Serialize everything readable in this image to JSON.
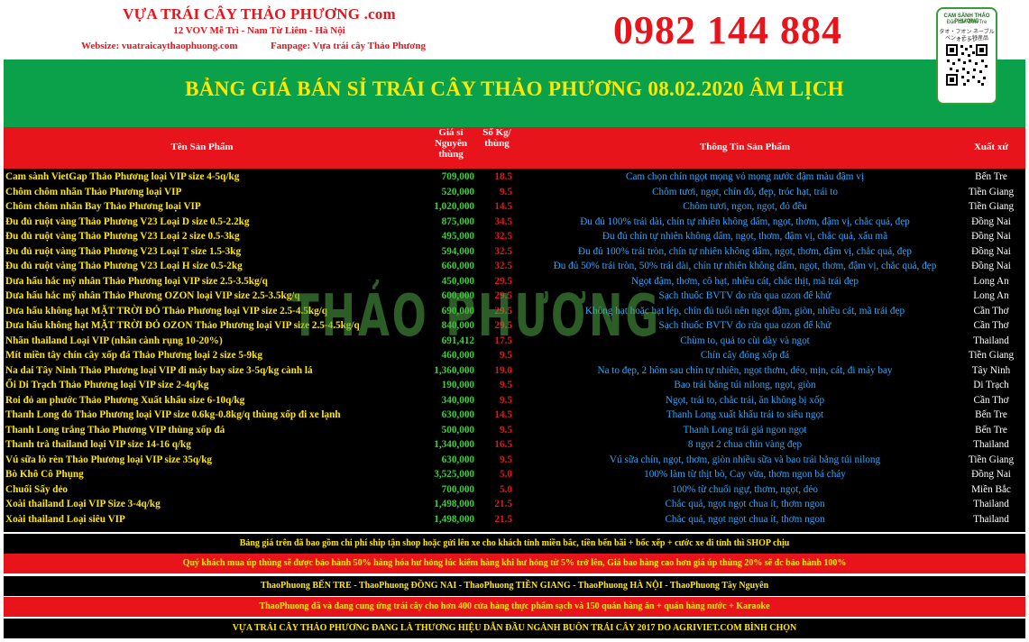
{
  "header": {
    "shop_name": "VỰA TRÁI CÂY THẢO PHƯƠNG .com",
    "address": "12 VOV Mễ Trì - Nam Từ Liêm - Hà Nội",
    "website": "Websize: vuatraicaythaophuong.com",
    "fanpage": "Fanpage: Vựa trái cây Thảo Phương",
    "phone": "0982 144 884",
    "badge_line1": "CAM SÀNH THẢO PHƯƠNG",
    "badge_line2": "Đặc sản Bến Tre",
    "badge_line3": "タオ・フオン ネーブルオレンジ",
    "badge_line4": "ベン・チェ特産品"
  },
  "title": "BẢNG GIÁ BÁN SỈ TRÁI CÂY THẢO PHƯƠNG 08.02.2020 ÂM LỊCH",
  "columns": {
    "name": "Tên Sản Phẩm",
    "price": "Giá sỉ Nguyên thùng",
    "kg": "Số Kg/ thùng",
    "info": "Thông Tin Sản Phẩm",
    "origin": "Xuất xứ"
  },
  "watermark": "THẢO PHƯƠNG",
  "products": [
    {
      "name": "Cam sành VietGap Thảo Phương loại VIP size 4-5q/kg",
      "price": "709,000",
      "kg": "18.5",
      "info": "Cam chọn chín ngọt mọng vỏ mọng nước đậm màu đậm vị",
      "origin": "Bến Tre"
    },
    {
      "name": "Chôm chôm nhãn Thảo Phương loại VIP",
      "price": "520,000",
      "kg": "9.5",
      "info": "Chôm tươi, ngọt, chín đỏ, đẹp, tróc hạt, trái to",
      "origin": "Tiền Giang"
    },
    {
      "name": "Chôm chôm nhãn Bay Thảo Phương loại VIP",
      "price": "1,020,000",
      "kg": "14.5",
      "info": "Chôm tươi, ngon, ngọt, đỏ đều",
      "origin": "Tiền Giang"
    },
    {
      "name": "Đu đủ ruột vàng Thảo Phương V23 Loại D size 0.5-2.2kg",
      "price": "875,000",
      "kg": "34.5",
      "info": "Đu đủ 100% trái dài, chín tự nhiên không dấm, ngọt, thơm, đậm vị, chắc quả, đẹp",
      "origin": "Đồng Nai"
    },
    {
      "name": "Đu đủ ruột vàng Thảo Phương V23 Loại 2 size 0.5-3kg",
      "price": "495,000",
      "kg": "32.5",
      "info": "Đu đủ chín tự nhiên không dấm, ngọt, thơm, đậm vị, chắc quả, xấu mã",
      "origin": "Đồng Nai"
    },
    {
      "name": "Đu đủ ruột vàng Thảo Phương V23 Loại T size 1.5-3kg",
      "price": "594,000",
      "kg": "32.5",
      "info": "Đu đủ 100% trái tròn, chín tự nhiên không dấm, ngọt, thơm, đậm vị, chắc quả, đẹp",
      "origin": "Đồng Nai"
    },
    {
      "name": "Đu đủ ruột vàng Thảo Phương V23 Loại H size 0.5-2kg",
      "price": "660,000",
      "kg": "32.5",
      "info": "Đu đủ 50% trái tròn, 50% trái dài, chín tự nhiên không dấm, ngọt, thơm, đậm vị, chắc quả, đẹp",
      "origin": "Đồng Nai"
    },
    {
      "name": "Dưa hấu hắc mỹ nhân Thảo Phương loại VIP size 2.5-3.5kg/q",
      "price": "450,000",
      "kg": "29.5",
      "info": "Ngọt đậm, thơm, cô hạt, nhiều cát, chắc thịt, mã trái đẹp",
      "origin": "Long An"
    },
    {
      "name": "Dưa hấu hắc mỹ nhân Thảo Phương OZON loại VIP size 2.5-3.5kg/q",
      "price": "600,000",
      "kg": "29.5",
      "info": "Sạch thuốc BVTV do rửa qua ozon để khử",
      "origin": "Long An"
    },
    {
      "name": "Dưa hấu không hạt MẶT TRỜI ĐỎ Thảo Phương loại VIP size 2.5-4.5kg/q",
      "price": "690,000",
      "kg": "29.5",
      "info": "Không hạt hoặc hạt lép, chín đủ tuổi nên ngọt đậm, giòn, nhiều cát, mã trái đẹp",
      "origin": "Cần Thơ"
    },
    {
      "name": "Dưa hấu không hạt MẶT TRỜI ĐỎ OZON Thảo Phương loại VIP size 2.5-4.5kg/q",
      "price": "840,000",
      "kg": "29.5",
      "info": "Sạch thuốc BVTV do rửa qua ozon để khử",
      "origin": "Cần Thơ"
    },
    {
      "name": "Nhãn thailand Loại VIP (nhãn cành rụng 10-20%)",
      "price": "691,412",
      "kg": "17.5",
      "info": "Chùm to, quả to cùi dày và ngọt",
      "origin": "Thailand"
    },
    {
      "name": "Mít miền tây chín cây xốp đá  Thảo Phương loại 2 size 5-9kg",
      "price": "460,000",
      "kg": "9.5",
      "info": "Chín cây đóng xốp đá",
      "origin": "Tiền Giang"
    },
    {
      "name": "Na dai Tây Ninh Thảo Phương loại VIP đi máy bay size 3-5q/kg cành lá",
      "price": "1,360,000",
      "kg": "19.0",
      "info": "Na to đẹp, 2 hôm sau chín tự nhiên, ngọt thơm, dẻo, mịn, cát, đi máy bay",
      "origin": "Tây Ninh"
    },
    {
      "name": "Ổi Di Trạch Thảo Phương loại VIP size 2-4q/kg",
      "price": "190,000",
      "kg": "9.5",
      "info": "Bao trái bằng túi nilong, ngọt, giòn",
      "origin": "Di Trạch"
    },
    {
      "name": "Roi đỏ an phước Thảo Phương Xuất khẩu size 6-10q/kg",
      "price": "340,000",
      "kg": "9.5",
      "info": "Ngọt, trái to, chắc trái, ăn không bị xốp",
      "origin": "Cần Thơ"
    },
    {
      "name": "Thanh Long đỏ Thảo Phương loại VIP  size 0.6kg-0.8kg/q thùng xốp đi xe lạnh",
      "price": "630,000",
      "kg": "14.5",
      "info": "Thanh Long xuất khẩu trái to siêu ngọt",
      "origin": "Bến Tre"
    },
    {
      "name": "Thanh Long trắng Thảo Phương VIP thùng xốp đá",
      "price": "500,000",
      "kg": "9.5",
      "info": "Thanh Long trái giả ngon ngọt",
      "origin": "Bến Tre"
    },
    {
      "name": "Thanh trà thailand loại VIP size 14-16 q/kg",
      "price": "1,340,000",
      "kg": "16.5",
      "info": "8 ngọt 2 chua chín vàng đẹp",
      "origin": "Thailand"
    },
    {
      "name": "Vú sữa lò rèn Thảo Phương loại VIP size 35q/kg",
      "price": "630,000",
      "kg": "9.5",
      "info": "Vú sữa chín, ngọt, thơm, giòn nhiều sữa và bao trái bằng túi nilong",
      "origin": "Tiền Giang"
    },
    {
      "name": "Bò Khô Cô Phụng",
      "price": "3,525,000",
      "kg": "5.0",
      "info": "100% làm từ thịt bò, Cay vừa, thơm ngon bá cháy",
      "origin": "Đồng Nai"
    },
    {
      "name": "Chuối Sấy dẻo",
      "price": "700,000",
      "kg": "5.0",
      "info": "100% từ chuối ngự, thơm, ngọt, dẻo",
      "origin": "Miền Bắc"
    },
    {
      "name": "Xoài thailand Loại VIP Size 3-4q/kg",
      "price": "1,498,000",
      "kg": "21.5",
      "info": "Chắc quả, ngọt ngọt chua ít, thơm ngon",
      "origin": "Thailand"
    },
    {
      "name": "Xoài thailand Loại siêu VIP",
      "price": "1,498,000",
      "kg": "21.5",
      "info": "Chắc quả, ngọt ngọt chua ít, thơm ngon",
      "origin": "Thailand"
    }
  ],
  "footer": {
    "line1": "Bảng giá trên đã bao gồm chi phí ship tận shop hoặc gửi lên xe cho khách tỉnh miền bắc, tiền bến bãi + bốc xếp + cước xe đi tỉnh thì SHOP chịu",
    "line2": "Quý khách mua úp thùng sẽ được bảo hành 50% hàng hóa hư hỏng lúc kiểm hàng khi hư hỏng từ 5% trở lên, Giá bao hàng cao hơn giá úp thùng 20% sẽ đc bảo hành 100%",
    "line3": "ThaoPhuong BẾN TRE - ThaoPhuong ĐỒNG NAI - ThaoPhuong TIỀN GIANG - ThaoPhuong HÀ NỘI - ThaoPhuong Tây Nguyên",
    "line4": "ThaoPhuong đã và đang cung ứng trái cây cho hơn 400 cửa hàng thực phẩm sạch và 150 quán hàng ăn + quán hàng nước + Karaoke",
    "line5": "VỰA TRÁI CÂY THẢO PHƯƠNG ĐANG LÀ THƯƠNG HIỆU DẪN ĐẦU NGÀNH BUÔN TRÁI CÂY 2017 DO AGRIVIET.COM BÌNH CHỌN"
  }
}
